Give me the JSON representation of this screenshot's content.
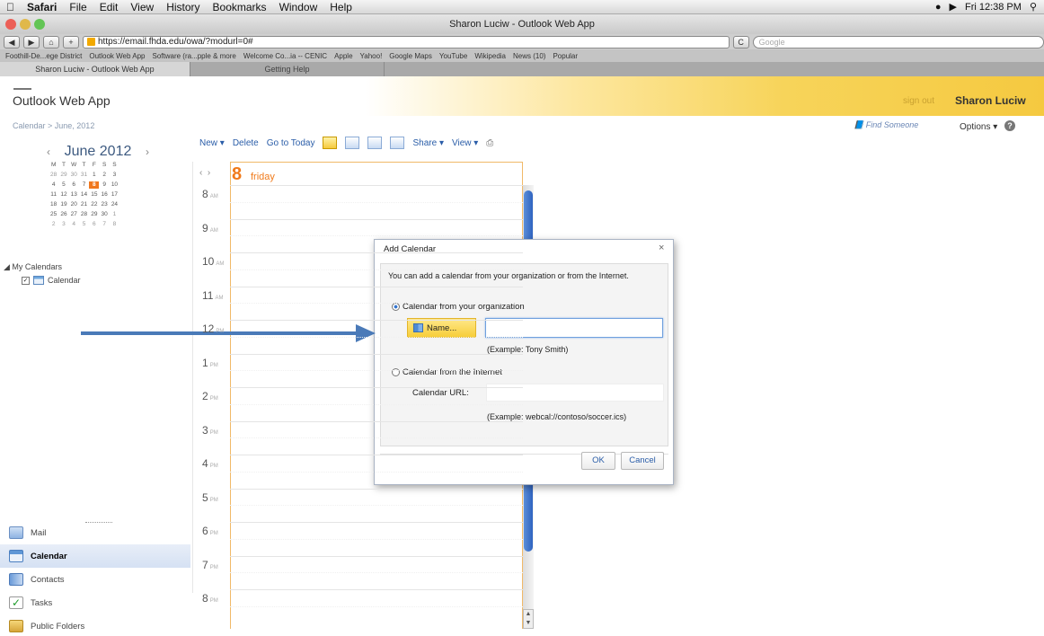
{
  "menubar": {
    "apple": "",
    "items": [
      "Safari",
      "File",
      "Edit",
      "View",
      "History",
      "Bookmarks",
      "Window",
      "Help"
    ],
    "clock": "Fri 12:38 PM"
  },
  "window": {
    "title": "Sharon Luciw - Outlook Web App"
  },
  "browser": {
    "url": "https://email.fhda.edu/owa/?modurl=0#",
    "search_placeholder": "Google",
    "bookmarks": [
      "Foothill-De...ege District",
      "Outlook Web App",
      "Software (ra...pple & more",
      "Welcome Co...ia -- CENIC",
      "Apple",
      "Yahoo!",
      "Google Maps",
      "YouTube",
      "Wikipedia",
      "News (10)",
      "Popular"
    ],
    "tabs": [
      "Sharon Luciw - Outlook Web App",
      "Getting Help"
    ]
  },
  "owa": {
    "logo": "Outlook Web App",
    "sign_out": "sign out",
    "user": "Sharon Luciw",
    "breadcrumb": "Calendar  >  June, 2012",
    "find_someone": "Find Someone",
    "options": "Options",
    "help": "?"
  },
  "mini_calendar": {
    "month": "June 2012",
    "weekdays": [
      "M",
      "T",
      "W",
      "T",
      "F",
      "S",
      "S"
    ],
    "weeks": [
      [
        "28",
        "29",
        "30",
        "31",
        "1",
        "2",
        "3"
      ],
      [
        "4",
        "5",
        "6",
        "7",
        "8",
        "9",
        "10"
      ],
      [
        "11",
        "12",
        "13",
        "14",
        "15",
        "16",
        "17"
      ],
      [
        "18",
        "19",
        "20",
        "21",
        "22",
        "23",
        "24"
      ],
      [
        "25",
        "26",
        "27",
        "28",
        "29",
        "30",
        "1"
      ],
      [
        "2",
        "3",
        "4",
        "5",
        "6",
        "7",
        "8"
      ]
    ],
    "selected": "8"
  },
  "my_calendars": {
    "heading": "My Calendars",
    "item": "Calendar"
  },
  "nav": [
    "Mail",
    "Calendar",
    "Contacts",
    "Tasks",
    "Public Folders"
  ],
  "cal_toolbar": {
    "new": "New",
    "delete": "Delete",
    "today": "Go to Today",
    "share": "Share",
    "view": "View"
  },
  "day": {
    "number": "8",
    "name": "friday"
  },
  "hours": [
    {
      "h": "8",
      "ap": "AM"
    },
    {
      "h": "9",
      "ap": "AM"
    },
    {
      "h": "10",
      "ap": "AM"
    },
    {
      "h": "11",
      "ap": "AM"
    },
    {
      "h": "12",
      "ap": "PM"
    },
    {
      "h": "1",
      "ap": "PM"
    },
    {
      "h": "2",
      "ap": "PM"
    },
    {
      "h": "3",
      "ap": "PM"
    },
    {
      "h": "4",
      "ap": "PM"
    },
    {
      "h": "5",
      "ap": "PM"
    },
    {
      "h": "6",
      "ap": "PM"
    },
    {
      "h": "7",
      "ap": "PM"
    },
    {
      "h": "8",
      "ap": "PM"
    }
  ],
  "dialog": {
    "title": "Add Calendar",
    "close": "×",
    "description": "You can add a calendar from your organization or from the Internet.",
    "opt_org": "Calendar from your organization",
    "name_button": "Name...",
    "name_value": "",
    "example_org": "(Example: Tony Smith)",
    "opt_net": "Calendar from the Internet",
    "url_label": "Calendar URL:",
    "url_value": "",
    "example_net": "(Example: webcal://contoso/soccer.ics)",
    "ok": "OK",
    "cancel": "Cancel"
  },
  "colors": {
    "accent_orange": "#f07a1a",
    "link_blue": "#2a5da8",
    "arrow_blue": "#4a7ab8"
  }
}
